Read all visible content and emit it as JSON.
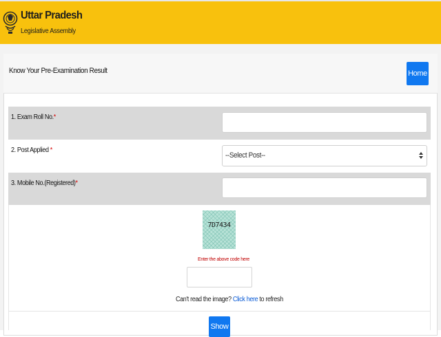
{
  "header": {
    "brand_name": "Uttar Pradesh",
    "brand_sub": "Legislative Assembly",
    "emblem_icon": "state-emblem-icon",
    "background": "#f8c10d"
  },
  "card": {
    "title": "Know Your Pre-Examination Result",
    "home_label": "Home"
  },
  "form": {
    "roll_no": {
      "label": "1. Exam Roll No.",
      "required_mark": "*",
      "value": ""
    },
    "post": {
      "label": "2. Post Applied",
      "required_mark": "*",
      "selected": "--Select Post--",
      "arrow_icon": "select-arrows-icon"
    },
    "mobile": {
      "label": "3. Mobile No.(Registered)",
      "required_mark": "*",
      "value": ""
    }
  },
  "captcha": {
    "code": "7D7434",
    "hint": "Enter the above code here",
    "input_value": "",
    "refresh_prefix": "Can't read the image? ",
    "refresh_link": "Click here",
    "refresh_suffix": " to refresh"
  },
  "actions": {
    "show_label": "Show",
    "accent": "#1078f0"
  }
}
